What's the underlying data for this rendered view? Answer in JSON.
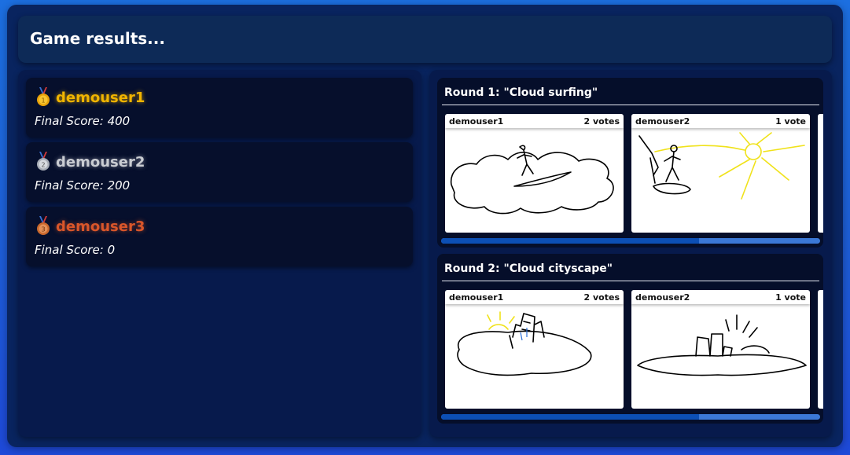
{
  "header": {
    "title": "Game results..."
  },
  "players": [
    {
      "name": "demouser1",
      "score_label": "Final Score: 400",
      "medal": "gold-medal-icon",
      "rank": "1",
      "color": "#f0b400",
      "medal_color": "#e9a30a"
    },
    {
      "name": "demouser2",
      "score_label": "Final Score: 200",
      "medal": "silver-medal-icon",
      "rank": "2",
      "color": "#c9ccd2",
      "medal_color": "#a8adb7"
    },
    {
      "name": "demouser3",
      "score_label": "Final Score: 0",
      "medal": "bronze-medal-icon",
      "rank": "3",
      "color": "#d9562a",
      "medal_color": "#c9682d"
    }
  ],
  "rounds": [
    {
      "title": "Round 1: \"Cloud surfing\"",
      "progress": 0.68,
      "drawings": [
        {
          "author": "demouser1",
          "votes": "2 votes"
        },
        {
          "author": "demouser2",
          "votes": "1 vote"
        }
      ]
    },
    {
      "title": "Round 2: \"Cloud cityscape\"",
      "progress": 0.68,
      "drawings": [
        {
          "author": "demouser1",
          "votes": "2 votes"
        },
        {
          "author": "demouser2",
          "votes": "1 vote"
        }
      ]
    }
  ]
}
